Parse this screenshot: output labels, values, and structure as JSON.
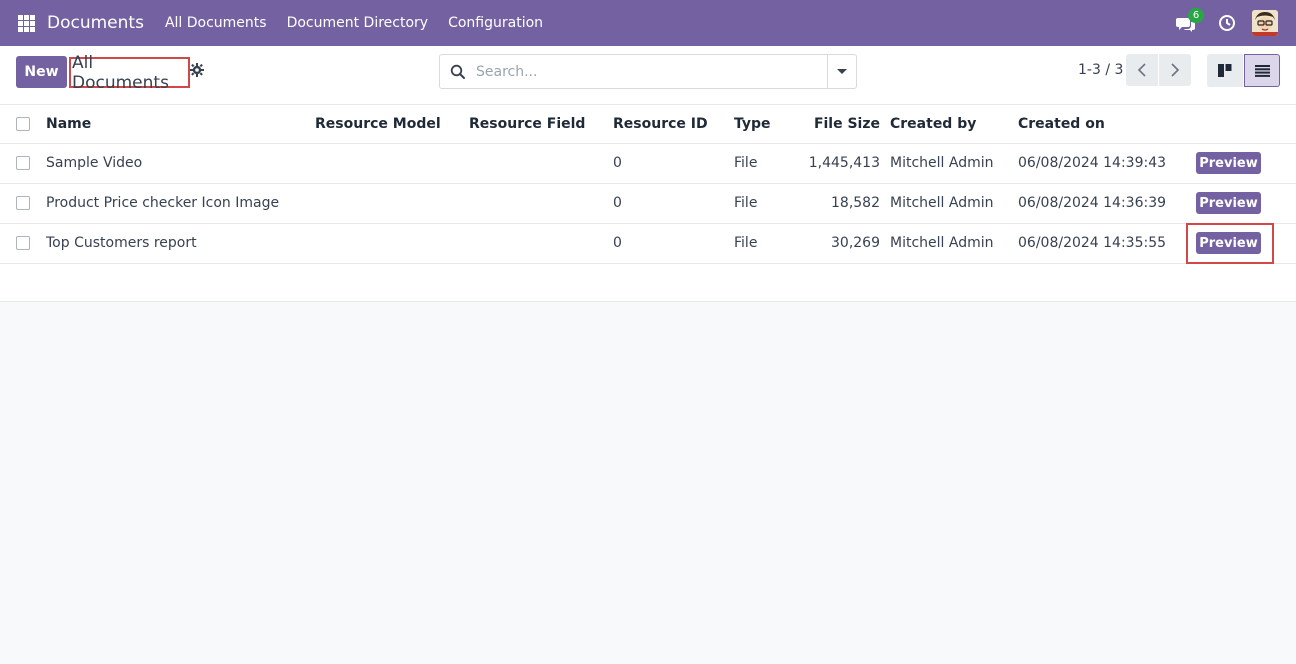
{
  "navbar": {
    "brand": "Documents",
    "menu": [
      "All Documents",
      "Document Directory",
      "Configuration"
    ],
    "chat_count": "6"
  },
  "control": {
    "new_label": "New",
    "title": "All Documents",
    "search_placeholder": "Search...",
    "pager": "1-3 / 3"
  },
  "table": {
    "headers": {
      "name": "Name",
      "resource_model": "Resource Model",
      "resource_field": "Resource Field",
      "resource_id": "Resource ID",
      "type": "Type",
      "file_size": "File Size",
      "created_by": "Created by",
      "created_on": "Created on"
    },
    "rows": [
      {
        "name": "Sample Video",
        "resource_model": "",
        "resource_field": "",
        "resource_id": "0",
        "type": "File",
        "file_size": "1,445,413",
        "created_by": "Mitchell Admin",
        "created_on": "06/08/2024 14:39:43",
        "action": "Preview"
      },
      {
        "name": "Product Price checker Icon Image",
        "resource_model": "",
        "resource_field": "",
        "resource_id": "0",
        "type": "File",
        "file_size": "18,582",
        "created_by": "Mitchell Admin",
        "created_on": "06/08/2024 14:36:39",
        "action": "Preview"
      },
      {
        "name": "Top Customers report",
        "resource_model": "",
        "resource_field": "",
        "resource_id": "0",
        "type": "File",
        "file_size": "30,269",
        "created_by": "Mitchell Admin",
        "created_on": "06/08/2024 14:35:55",
        "action": "Preview"
      }
    ]
  },
  "colors": {
    "brand": "#7461a1",
    "highlight": "#d04848",
    "badge": "#28a745"
  }
}
